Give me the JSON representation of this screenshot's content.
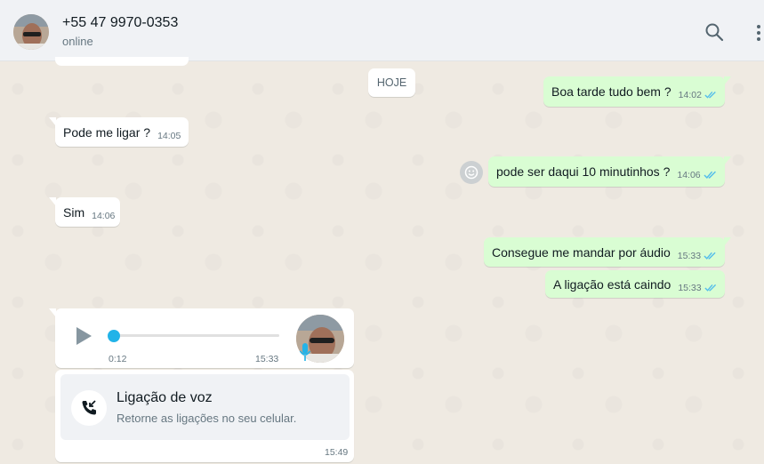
{
  "header": {
    "contact_name": "+55 47 9970-0353",
    "status": "online",
    "icons": [
      "search-icon",
      "menu-icon"
    ]
  },
  "date_separator": "HOJE",
  "messages": [
    {
      "direction": "out",
      "text": "Boa tarde tudo bem ?",
      "time": "14:02",
      "read": true
    },
    {
      "direction": "in",
      "text": "Pode me ligar  ?",
      "time": "14:05"
    },
    {
      "direction": "out",
      "text": "pode ser daqui 10 minutinhos ?",
      "time": "14:06",
      "read": true
    },
    {
      "direction": "in",
      "text": "Sim",
      "time": "14:06"
    },
    {
      "direction": "out",
      "text": "Consegue me mandar por áudio",
      "time": "15:33",
      "read": true
    },
    {
      "direction": "out",
      "text": "A ligação está caindo",
      "time": "15:33",
      "read": true
    }
  ],
  "audio_message": {
    "duration": "0:12",
    "time": "15:33",
    "progress": 0.0
  },
  "call_message": {
    "title": "Ligação de voz",
    "subtitle": "Retorne as ligações no seu celular.",
    "time": "15:49"
  },
  "colors": {
    "outgoing_bubble": "#d9fdd3",
    "incoming_bubble": "#ffffff",
    "chat_background": "#efeae2",
    "read_ticks": "#53bdeb",
    "audio_knob": "#22b3e8"
  }
}
